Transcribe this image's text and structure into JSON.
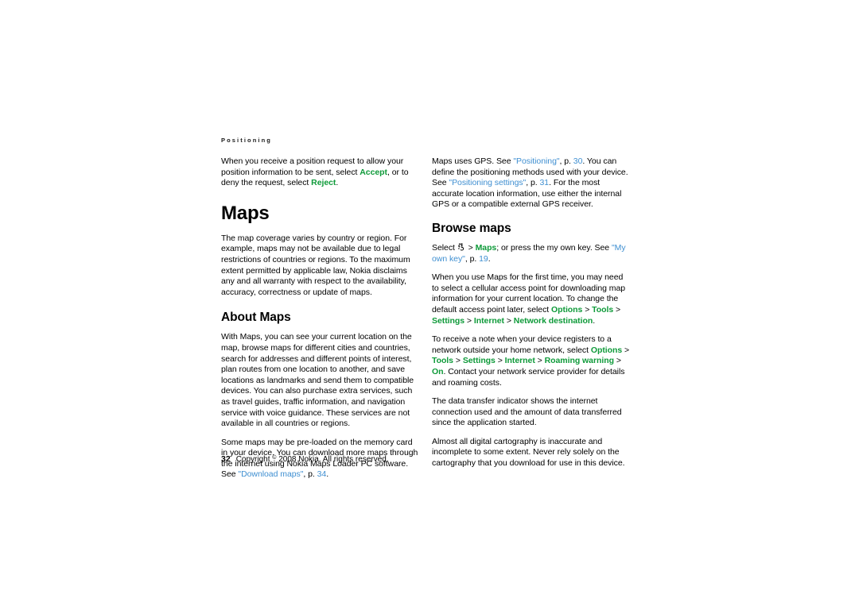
{
  "document": {
    "running_header": "Positioning",
    "footer": {
      "page_number": "32",
      "copyright": "Copyright © 2008 Nokia. All rights reserved.",
      "copyright_prefix": "Copyright ",
      "copyright_suffix": " 2008 Nokia. All rights reserved.",
      "registered_mark": "©"
    }
  },
  "left_column": {
    "intro_paragraph": {
      "part1": "When you receive a position request to allow your position information to be sent, select ",
      "ui1": "Accept",
      "part2": ", or to deny the request, select ",
      "ui2": "Reject",
      "part3": "."
    },
    "chapter_heading": "Maps",
    "coverage_paragraph": "The map coverage varies by country or region. For example, maps may not be available due to legal restrictions of countries or regions. To the maximum extent permitted by applicable law, Nokia disclaims any and all warranty with respect to the availability, accuracy, correctness or update of maps.",
    "section_heading": "About Maps",
    "about_paragraph": "With Maps, you can see your current location on the map, browse maps for different cities and countries, search for addresses and different points of interest, plan routes from one location to another, and save locations as landmarks and send them to compatible devices. You can also purchase extra services, such as travel guides, traffic information, and navigation service with voice guidance. These services are not available in all countries or regions.",
    "preloaded_paragraph": {
      "part1": "Some maps may be pre-loaded on the memory card in your device. You can download more maps through the internet using Nokia Maps Loader PC software. See ",
      "xref_title": "\"Download maps\"",
      "part2": ", p. ",
      "xref_page": "34",
      "part3": "."
    }
  },
  "right_column": {
    "gps_paragraph": {
      "part1": "Maps uses GPS. See ",
      "xref1_title": "\"Positioning\"",
      "part2": ", p. ",
      "xref1_page": "30",
      "part3": ". You can define the positioning methods used with your device. See ",
      "xref2_title": "\"Positioning settings\"",
      "part4": ", p. ",
      "xref2_page": "31",
      "part5": ". For the most accurate location information, use either the internal GPS or a compatible external GPS receiver."
    },
    "section_heading": "Browse maps",
    "select_paragraph": {
      "part1": "Select ",
      "icon": "symbian-menu-icon",
      "sep1": " > ",
      "ui1": "Maps",
      "part2": "; or press the my own key. See ",
      "xref_title": "\"My own key\"",
      "part3": ", p. ",
      "xref_page": "19",
      "part4": "."
    },
    "first_time_paragraph": {
      "part1": "When you use Maps for the first time, you may need to select a cellular access point for downloading map information for your current location. To change the default access point later, select ",
      "path": [
        "Options",
        "Tools",
        "Settings",
        "Internet",
        "Network destination"
      ],
      "separator": " > ",
      "part2": "."
    },
    "roaming_paragraph": {
      "part1": "To receive a note when your device registers to a network outside your home network, select ",
      "path": [
        "Options",
        "Tools",
        "Settings",
        "Internet",
        "Roaming warning",
        "On"
      ],
      "separator": " > ",
      "part2": ". Contact your network service provider for details and roaming costs."
    },
    "data_indicator_paragraph": "The data transfer indicator shows the internet connection used and the amount of data transferred since the application started.",
    "cartography_paragraph": "Almost all digital cartography is inaccurate and incomplete to some extent. Never rely solely on the cartography that you download for use in this device."
  },
  "colors": {
    "ui_green": "#0e9a39",
    "xref_blue": "#3f8fd1",
    "body_text": "#000000",
    "page_background": "#ffffff"
  }
}
